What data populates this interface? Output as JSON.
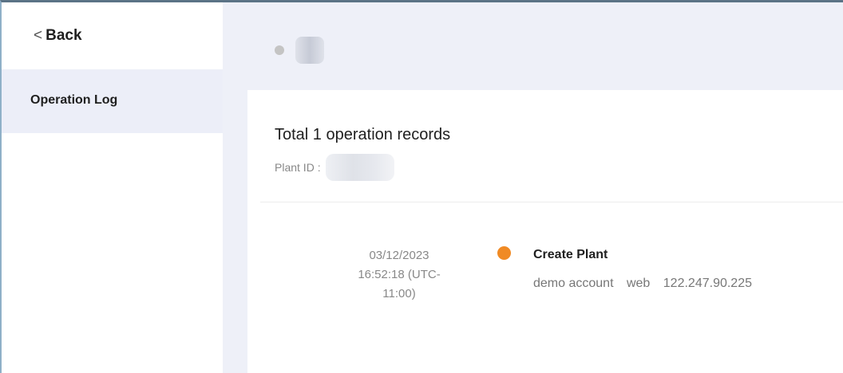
{
  "sidebar": {
    "back_label": "Back",
    "items": [
      {
        "label": "Operation Log",
        "active": true
      }
    ]
  },
  "header": {
    "status_dot_color": "#c4c4c4"
  },
  "content": {
    "records_title": "Total 1 operation records",
    "plant_id_label": "Plant ID :",
    "entries": [
      {
        "date": "03/12/2023",
        "time": "16:52:18 (UTC-",
        "tz": "11:00)",
        "action": "Create Plant",
        "user": "demo account",
        "source": "web",
        "ip": "122.247.90.225",
        "dot_color": "#f08a24"
      }
    ]
  }
}
